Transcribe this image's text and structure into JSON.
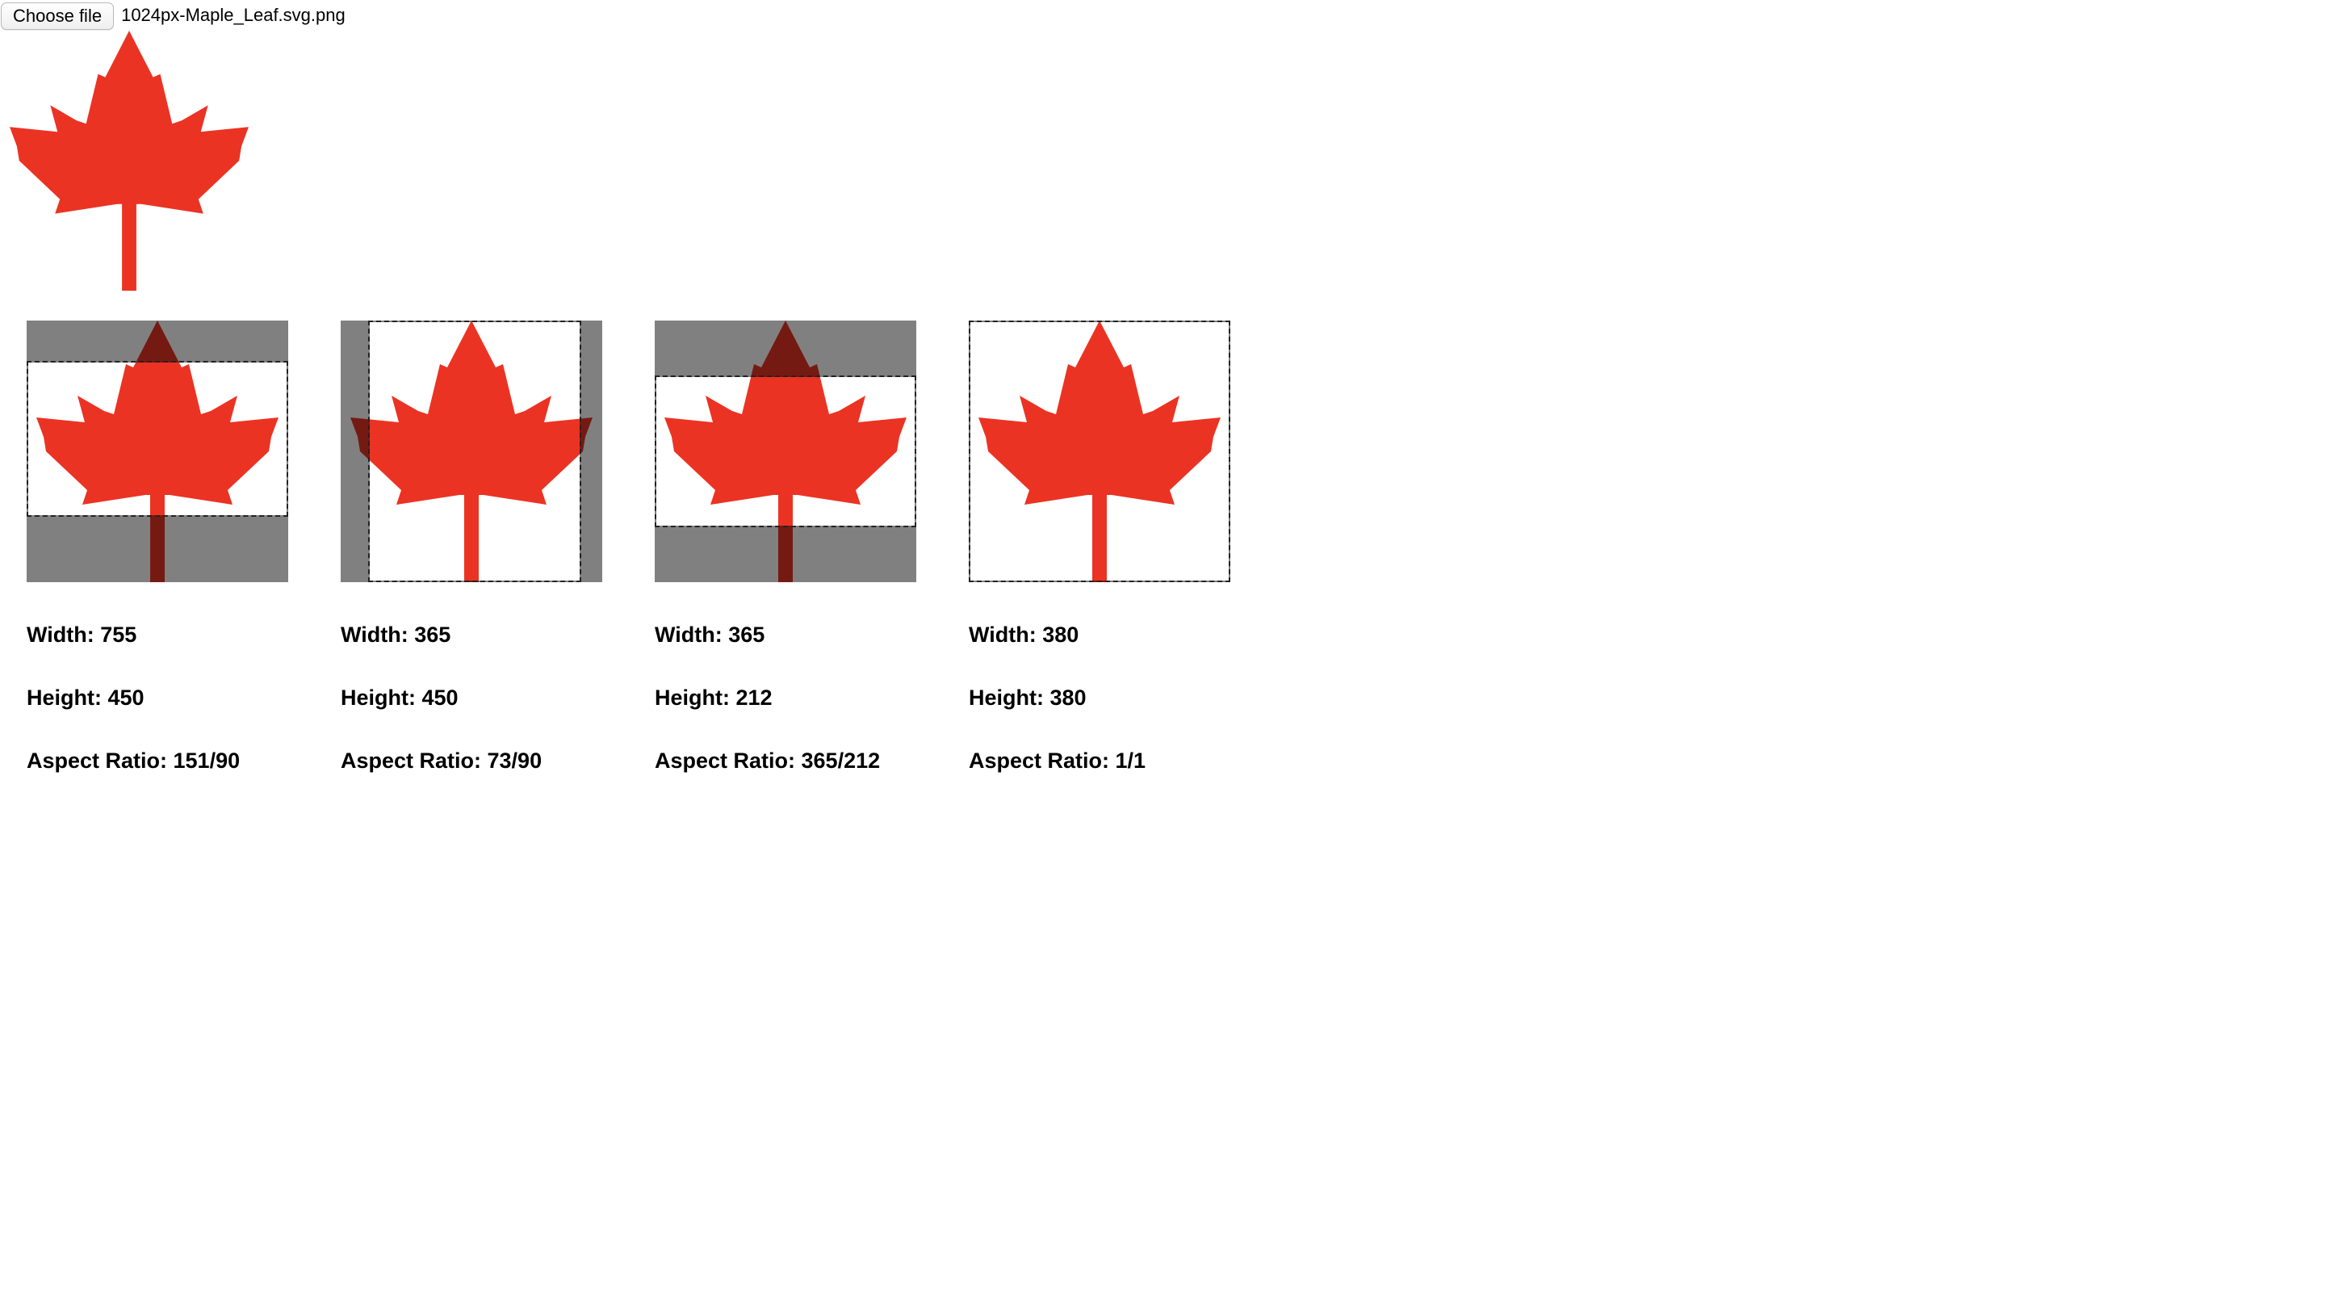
{
  "file_input": {
    "button_label": "Choose file",
    "file_name": "1024px-Maple_Leaf.svg.png"
  },
  "colors": {
    "leaf_red": "#eb3323",
    "leaf_dark": "#751a12",
    "mask_gray": "#808080",
    "background": "#ffffff"
  },
  "crops": [
    {
      "width_label": "Width: 755",
      "height_label": "Height: 450",
      "ratio_label": "Aspect Ratio: 151/90"
    },
    {
      "width_label": "Width: 365",
      "height_label": "Height: 450",
      "ratio_label": "Aspect Ratio: 73/90"
    },
    {
      "width_label": "Width: 365",
      "height_label": "Height: 212",
      "ratio_label": "Aspect Ratio: 365/212"
    },
    {
      "width_label": "Width: 380",
      "height_label": "Height: 380",
      "ratio_label": "Aspect Ratio: 1/1"
    }
  ]
}
